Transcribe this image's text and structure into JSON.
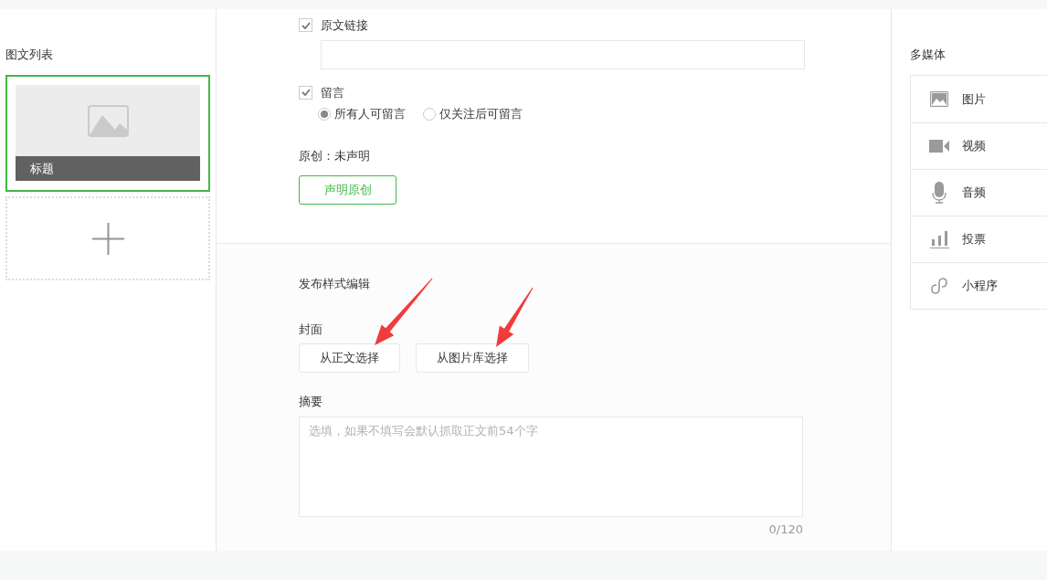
{
  "article_list": {
    "title": "图文列表",
    "articles": [
      {
        "title": "标题",
        "selected": true
      }
    ]
  },
  "settings": {
    "original_link": {
      "label": "原文链接",
      "checked": true
    },
    "comments": {
      "label": "留言",
      "checked": true,
      "options": [
        {
          "label": "所有人可留言",
          "selected": true
        },
        {
          "label": "仅关注后可留言",
          "selected": false
        }
      ]
    },
    "originality_status": "原创：未声明",
    "declare_button": "声明原创"
  },
  "publish_style": {
    "title": "发布样式编辑",
    "cover": {
      "label": "封面",
      "buttons": [
        "从正文选择",
        "从图片库选择"
      ]
    },
    "summary": {
      "label": "摘要",
      "placeholder": "选填，如果不填写会默认抓取正文前54个字",
      "counter": "0/120"
    }
  },
  "media": {
    "title": "多媒体",
    "items": [
      {
        "label": "图片",
        "kind": "image"
      },
      {
        "label": "视频",
        "kind": "video"
      },
      {
        "label": "音频",
        "kind": "audio"
      },
      {
        "label": "投票",
        "kind": "vote"
      },
      {
        "label": "小程序",
        "kind": "miniprogram"
      }
    ]
  }
}
